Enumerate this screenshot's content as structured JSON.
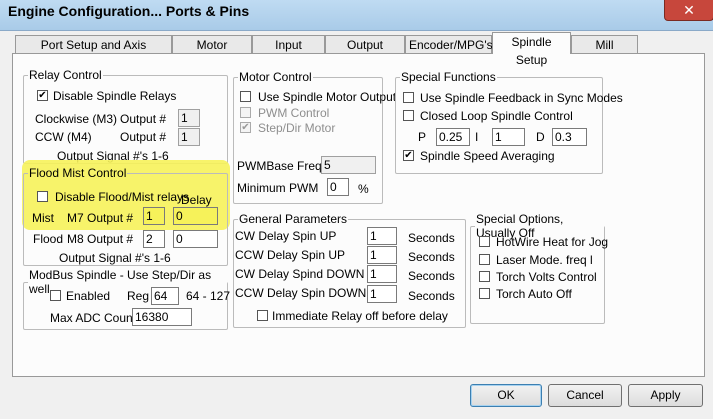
{
  "window": {
    "title": "Engine Configuration... Ports & Pins",
    "close": "✕"
  },
  "tabs": [
    "Port Setup and Axis Selection",
    "Motor Outputs",
    "Input Signals",
    "Output Signals",
    "Encoder/MPG's",
    "Spindle Setup",
    "Mill Options"
  ],
  "active_tab": "Spindle Setup",
  "relay": {
    "legend": "Relay Control",
    "disable_label": "Disable Spindle Relays",
    "disable_checked": true,
    "cw_label": "Clockwise (M3)",
    "ccw_label": "CCW (M4)",
    "output_label": "Output #",
    "cw_value": "1",
    "ccw_value": "1",
    "footer": "Output Signal #'s 1-6"
  },
  "flood": {
    "legend": "Flood Mist Control",
    "disable_label": "Disable Flood/Mist relays",
    "disable_checked": false,
    "delay_label": "Delay",
    "mist_label": "Mist",
    "m7_label": "M7 Output #",
    "m7_value": "1",
    "m7_delay": "0",
    "flood_label": "Flood",
    "m8_label": "M8 Output #",
    "m8_value": "2",
    "m8_delay": "0",
    "footer": "Output Signal #'s 1-6"
  },
  "modbus": {
    "legend": "ModBus Spindle - Use Step/Dir as well",
    "enabled_label": "Enabled",
    "enabled_checked": false,
    "reg_label": "Reg",
    "reg_value": "64",
    "reg_range": "64 - 127",
    "adc_label": "Max ADC Count",
    "adc_value": "16380"
  },
  "motor": {
    "legend": "Motor Control",
    "use_label": "Use Spindle Motor Output",
    "use_checked": false,
    "pwm_label": "PWM Control",
    "pwm_checked": false,
    "stepdir_label": "Step/Dir Motor",
    "stepdir_checked": true,
    "base_label": "PWMBase Freq.",
    "base_value": "5",
    "min_label": "Minimum PWM",
    "min_value": "0",
    "min_unit": "%"
  },
  "general": {
    "legend": "General Parameters",
    "rows": [
      {
        "label": "CW Delay Spin UP",
        "value": "1",
        "unit": "Seconds"
      },
      {
        "label": "CCW Delay Spin UP",
        "value": "1",
        "unit": "Seconds"
      },
      {
        "label": "CW Delay Spind DOWN",
        "value": "1",
        "unit": "Seconds"
      },
      {
        "label": "CCW Delay Spin DOWN",
        "value": "1",
        "unit": "Seconds"
      }
    ],
    "immediate_label": "Immediate Relay off before delay",
    "immediate_checked": false
  },
  "special": {
    "legend": "Special Functions",
    "feedback_label": "Use Spindle Feedback in Sync Modes",
    "feedback_checked": false,
    "closed_label": "Closed Loop Spindle Control",
    "closed_checked": false,
    "p_label": "P",
    "p_value": "0.25",
    "i_label": "I",
    "i_value": "1",
    "d_label": "D",
    "d_value": "0.3",
    "avg_label": "Spindle Speed Averaging",
    "avg_checked": true
  },
  "options": {
    "legend": "Special Options, Usually Off",
    "items": [
      {
        "label": "HotWire Heat for Jog",
        "checked": false
      },
      {
        "label": "Laser Mode. freq l",
        "checked": false
      },
      {
        "label": "Torch Volts Control",
        "checked": false
      },
      {
        "label": "Torch Auto Off",
        "checked": false
      }
    ]
  },
  "buttons": {
    "ok": "OK",
    "cancel": "Cancel",
    "apply": "Apply"
  },
  "check_glyph": "✔"
}
